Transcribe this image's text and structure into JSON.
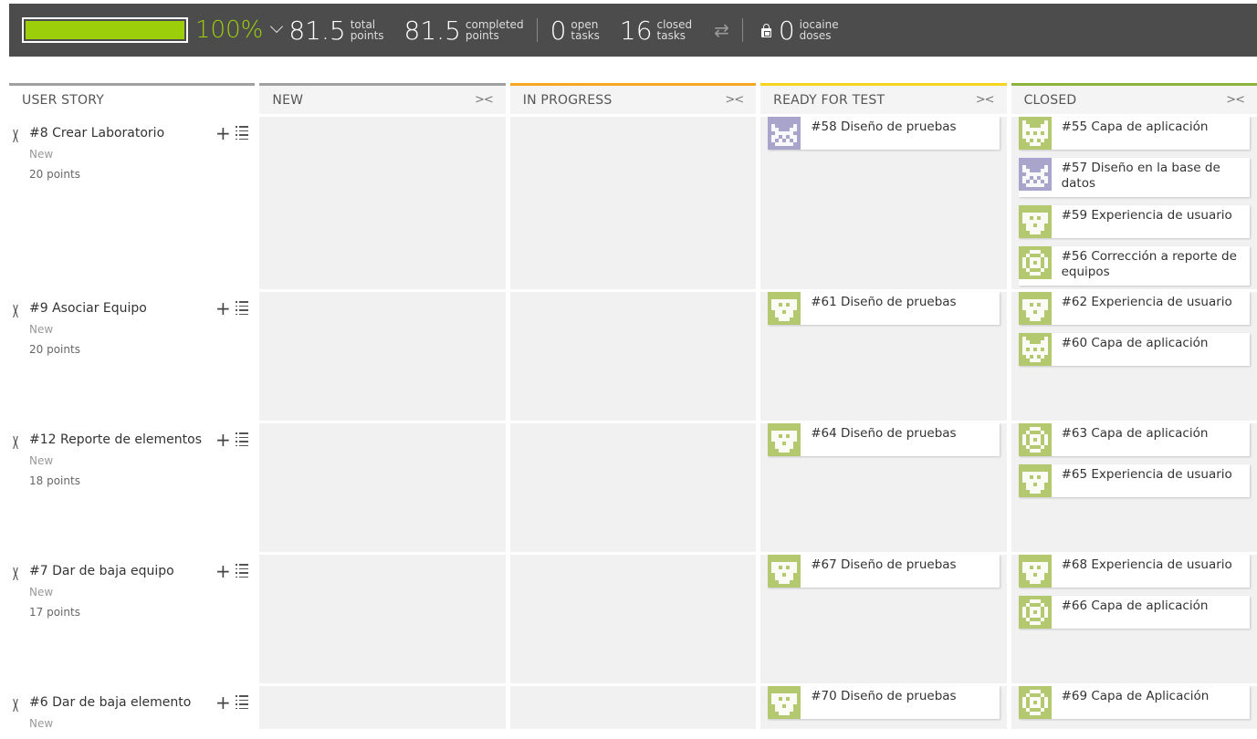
{
  "summary": {
    "progress_fraction": 1.0,
    "percent": "100%",
    "total_points": "81.5",
    "total_points_label_1": "total",
    "total_points_label_2": "points",
    "completed_points": "81.5",
    "completed_label_1": "completed",
    "completed_label_2": "points",
    "open_tasks": "0",
    "open_label_1": "open",
    "open_label_2": "tasks",
    "closed_tasks": "16",
    "closed_label_1": "closed",
    "closed_label_2": "tasks",
    "iocaine": "0",
    "iocaine_label_1": "iocaine",
    "iocaine_label_2": "doses",
    "swap_icon": "⇄"
  },
  "columns": {
    "user_story": "USER STORY",
    "new": "NEW",
    "in_progress": "IN PROGRESS",
    "ready_for_test": "READY FOR TEST",
    "closed": "CLOSED",
    "fold_icon": "><",
    "colors": {
      "user_story": "#a0a0a0",
      "new": "#a0a0a0",
      "in_progress": "#f5a623",
      "ready_for_test": "#f6d31c",
      "closed": "#8cb33c"
    }
  },
  "avatar_colors": {
    "purple": "#a8a4cc",
    "green": "#b4c870"
  },
  "rows": [
    {
      "us": {
        "title": "#8 Crear Laboratorio",
        "status": "New",
        "points": "20 points"
      },
      "ready": [
        {
          "title": "#58 Diseño de pruebas",
          "avatar": "purple",
          "icon": "owl-avatar-icon"
        }
      ],
      "closed": [
        {
          "title": "#55 Capa de aplicación",
          "avatar": "green",
          "icon": "cat-avatar-icon"
        },
        {
          "title": "#57 Diseño en la base de datos",
          "avatar": "purple",
          "icon": "owl-avatar-icon"
        },
        {
          "title": "#59 Experiencia de usuario",
          "avatar": "green",
          "icon": "bear-avatar-icon"
        },
        {
          "title": "#56 Corrección a reporte de equipos",
          "avatar": "green",
          "icon": "eye-avatar-icon"
        }
      ]
    },
    {
      "us": {
        "title": "#9 Asociar Equipo",
        "status": "New",
        "points": "20 points"
      },
      "ready": [
        {
          "title": "#61 Diseño de pruebas",
          "avatar": "green",
          "icon": "bear-avatar-icon"
        }
      ],
      "closed": [
        {
          "title": "#62 Experiencia de usuario",
          "avatar": "green",
          "icon": "bear-avatar-icon"
        },
        {
          "title": "#60 Capa de aplicación",
          "avatar": "green",
          "icon": "cat-avatar-icon"
        }
      ]
    },
    {
      "us": {
        "title": "#12 Reporte de elementos",
        "status": "New",
        "points": "18 points"
      },
      "ready": [
        {
          "title": "#64 Diseño de pruebas",
          "avatar": "green",
          "icon": "bear-avatar-icon"
        }
      ],
      "closed": [
        {
          "title": "#63 Capa de aplicación",
          "avatar": "green",
          "icon": "eye-avatar-icon"
        },
        {
          "title": "#65 Experiencia de usuario",
          "avatar": "green",
          "icon": "bear-avatar-icon"
        }
      ]
    },
    {
      "us": {
        "title": "#7 Dar de baja equipo",
        "status": "New",
        "points": "17 points"
      },
      "ready": [
        {
          "title": "#67 Diseño de pruebas",
          "avatar": "green",
          "icon": "bear-avatar-icon"
        }
      ],
      "closed": [
        {
          "title": "#68 Experiencia de usuario",
          "avatar": "green",
          "icon": "bear-avatar-icon"
        },
        {
          "title": "#66 Capa de aplicación",
          "avatar": "green",
          "icon": "eye-avatar-icon"
        }
      ]
    },
    {
      "us": {
        "title": "#6 Dar de baja elemento",
        "status": "New",
        "points": ""
      },
      "ready": [
        {
          "title": "#70 Diseño de pruebas",
          "avatar": "green",
          "icon": "bear-avatar-icon"
        }
      ],
      "closed": [
        {
          "title": "#69 Capa de Aplicación",
          "avatar": "green",
          "icon": "eye-avatar-icon"
        }
      ]
    }
  ]
}
